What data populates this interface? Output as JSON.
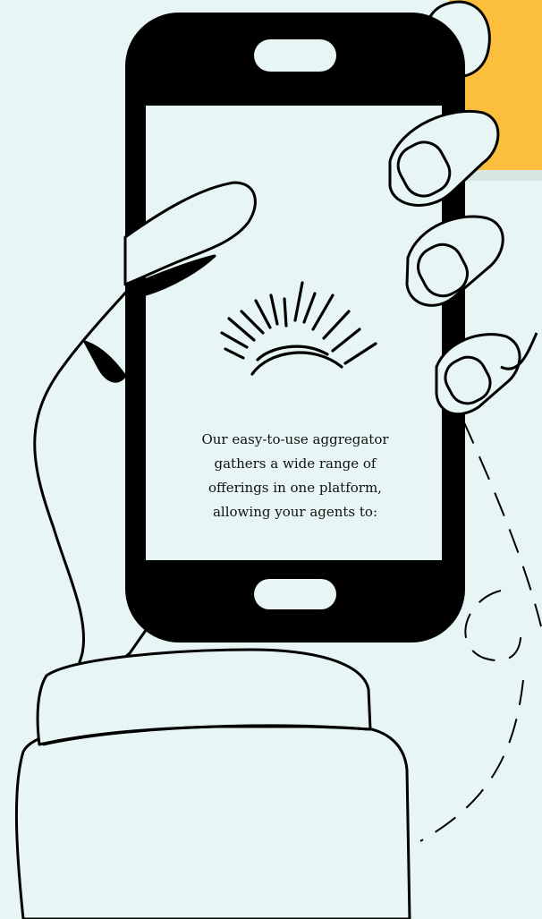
{
  "colors": {
    "background": "#e7f5f4",
    "accent": "#fbbf3d",
    "ink": "#000000",
    "screen": "#e7f5f4"
  },
  "icons": {
    "screen_graphic": "sunrise-icon"
  },
  "screen": {
    "lines": [
      "Our easy-to-use aggregator",
      "gathers a wide range of",
      "offerings in one platform,",
      "allowing your agents to:"
    ]
  }
}
